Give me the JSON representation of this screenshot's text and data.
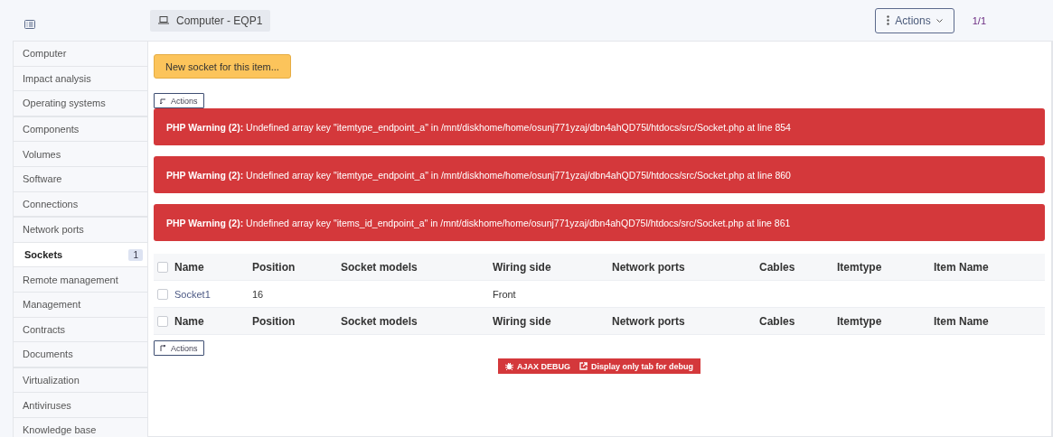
{
  "header": {
    "item_title": "Computer - EQP1",
    "actions_label": "Actions",
    "pager": "1/1"
  },
  "sidebar": {
    "groups": [
      {
        "items": [
          {
            "label": "Computer",
            "selected": false
          },
          {
            "label": "Impact analysis",
            "selected": false
          },
          {
            "label": "Operating systems",
            "selected": false
          }
        ]
      },
      {
        "items": [
          {
            "label": "Components",
            "selected": false
          },
          {
            "label": "Volumes",
            "selected": false
          },
          {
            "label": "Software",
            "selected": false
          },
          {
            "label": "Connections",
            "selected": false
          }
        ]
      },
      {
        "items": [
          {
            "label": "Network ports",
            "selected": false
          },
          {
            "label": "Sockets",
            "selected": true,
            "count": "1"
          },
          {
            "label": "Remote management",
            "selected": false
          },
          {
            "label": "Management",
            "selected": false
          },
          {
            "label": "Contracts",
            "selected": false
          },
          {
            "label": "Documents",
            "selected": false
          }
        ]
      },
      {
        "items": [
          {
            "label": "Virtualization",
            "selected": false
          },
          {
            "label": "Antiviruses",
            "selected": false
          },
          {
            "label": "Knowledge base",
            "selected": false
          }
        ]
      }
    ]
  },
  "content": {
    "new_button": "New socket for this item...",
    "top_actions": "Actions",
    "bottom_actions": "Actions",
    "warnings": [
      {
        "prefix": "PHP Warning (2):",
        "message": "Undefined array key \"itemtype_endpoint_a\" in /mnt/diskhome/home/osunj771yzaj/dbn4ahQD75l/htdocs/src/Socket.php at line 854"
      },
      {
        "prefix": "PHP Warning (2):",
        "message": "Undefined array key \"itemtype_endpoint_a\" in /mnt/diskhome/home/osunj771yzaj/dbn4ahQD75l/htdocs/src/Socket.php at line 860"
      },
      {
        "prefix": "PHP Warning (2):",
        "message": "Undefined array key \"items_id_endpoint_a\" in /mnt/diskhome/home/osunj771yzaj/dbn4ahQD75l/htdocs/src/Socket.php at line 861"
      }
    ],
    "table": {
      "header_checked": false,
      "footer_checked": false,
      "columns": [
        "Name",
        "Position",
        "Socket models",
        "Wiring side",
        "Network ports",
        "Cables",
        "Itemtype",
        "Item Name"
      ],
      "rows": [
        {
          "checked": false,
          "cells": [
            "Socket1",
            "16",
            "",
            "Front",
            "",
            "",
            "",
            ""
          ]
        }
      ],
      "footer_columns": [
        "Name",
        "Position",
        "Socket models",
        "Wiring side",
        "Network ports",
        "Cables",
        "Itemtype",
        "Item Name"
      ]
    },
    "debug": {
      "ajax": "AJAX DEBUG",
      "tab": "Display only tab for debug"
    }
  }
}
